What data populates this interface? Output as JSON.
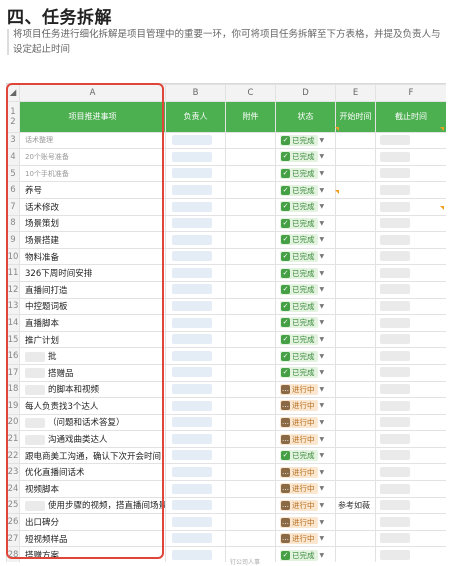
{
  "heading": "四、任务拆解",
  "description": "将项目任务进行细化拆解是项目管理中的重要一环，你可将项目任务拆解至下方表格，并提及负责人与设定起止时间",
  "sheet": {
    "columns": [
      "A",
      "B",
      "C",
      "D",
      "E",
      "F"
    ],
    "headers": {
      "task": "项目推进事项",
      "owner": "负责人",
      "attachment": "附件",
      "status": "状态",
      "start": "开始时间",
      "end": "截止时间"
    },
    "statuses": {
      "done": "已完成",
      "progress": "进行中"
    },
    "rows": [
      {
        "n": "3",
        "task": "话术整理",
        "light": true,
        "status": "done"
      },
      {
        "n": "4",
        "task": "20个账号准备",
        "light": true,
        "status": "done"
      },
      {
        "n": "5",
        "task": "10个手机准备",
        "light": true,
        "status": "done"
      },
      {
        "n": "6",
        "task": "养号",
        "status": "done"
      },
      {
        "n": "7",
        "task": "话术修改",
        "status": "done"
      },
      {
        "n": "8",
        "task": "场景策划",
        "status": "done"
      },
      {
        "n": "9",
        "task": "场景搭建",
        "status": "done"
      },
      {
        "n": "10",
        "task": "物料准备",
        "status": "done"
      },
      {
        "n": "11",
        "task": "326下周时间安排",
        "status": "done"
      },
      {
        "n": "12",
        "task": "直播间打造",
        "status": "done"
      },
      {
        "n": "13",
        "task": "中控题词板",
        "status": "done"
      },
      {
        "n": "14",
        "task": "直播脚本",
        "status": "done"
      },
      {
        "n": "15",
        "task": "推广计划",
        "status": "done"
      },
      {
        "n": "16",
        "task": "批",
        "indent": true,
        "status": "done"
      },
      {
        "n": "17",
        "task": "搭赠品",
        "indent": true,
        "status": "done"
      },
      {
        "n": "18",
        "task": "的脚本和视频",
        "indent": true,
        "status": "progress"
      },
      {
        "n": "19",
        "task": "每人负责找3个达人",
        "status": "progress"
      },
      {
        "n": "20",
        "task": "（问题和话术答复）",
        "indent": true,
        "status": "progress"
      },
      {
        "n": "21",
        "task": "沟通戏曲类达人",
        "indent": true,
        "status": "progress"
      },
      {
        "n": "22",
        "task": "跟电商美工沟通，确认下次开会时间",
        "status": "done"
      },
      {
        "n": "23",
        "task": "优化直播间话术",
        "status": "progress"
      },
      {
        "n": "24",
        "task": "视频脚本",
        "status": "progress"
      },
      {
        "n": "25",
        "task": "使用步骤的视频，搭直播间场景",
        "indent": true,
        "status": "progress",
        "start": "参考如薇"
      },
      {
        "n": "26",
        "task": "出口碑分",
        "status": "progress"
      },
      {
        "n": "27",
        "task": "短视频样品",
        "status": "progress"
      },
      {
        "n": "28",
        "task": "搭赠方案",
        "status": "done"
      },
      {
        "n": "29",
        "task": "补单",
        "status": "done"
      }
    ]
  },
  "footer_fragment": "钉公司人事"
}
